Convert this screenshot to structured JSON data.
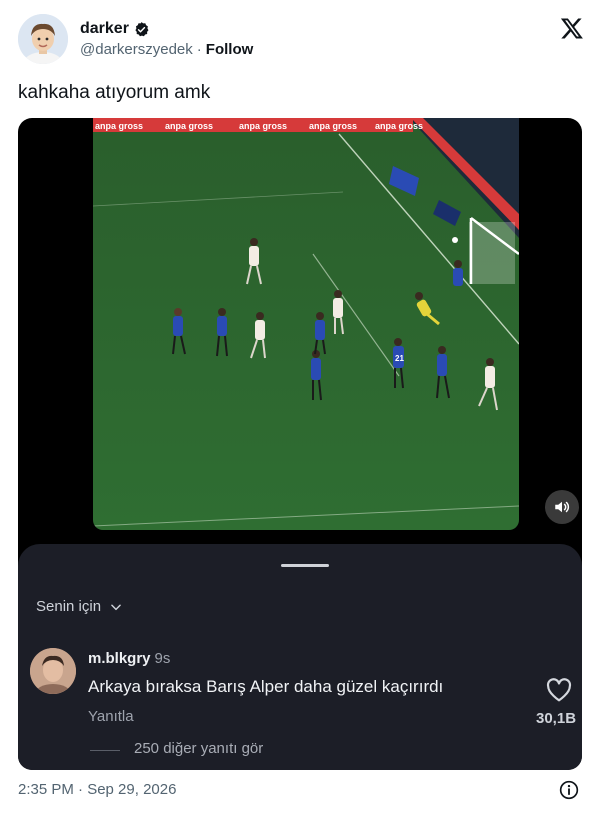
{
  "author": {
    "display_name": "darker",
    "handle": "@darkerszyedek",
    "separator": "·",
    "follow_label": "Follow",
    "verified_color": "#1d9bf0"
  },
  "platform_logo": "x-logo-icon",
  "tweet": {
    "text": "kahkaha atıyorum amk",
    "timestamp": "2:35 PM · Sep 29, 2026"
  },
  "video": {
    "board_ads": [
      "anpa gross",
      "anpa gross",
      "anpa gross",
      "anpa gross",
      "anpa gross"
    ],
    "player_number": "21",
    "sound_icon": "speaker-icon"
  },
  "comments_sheet": {
    "filter_label": "Senin için",
    "comment": {
      "username": "m.blkgry",
      "time": "9s",
      "text": "Arkaya bıraksa Barış Alper daha güzel kaçırırdı",
      "reply_label": "Yanıtla",
      "likes": "30,1B"
    },
    "more_replies_label": "250 diğer yanıtı gör"
  },
  "colors": {
    "sheet_bg": "#1c1e27",
    "pitch": "#2f6e32",
    "home_kit": "#2a4bb4",
    "away_kit": "#f3ece4"
  }
}
